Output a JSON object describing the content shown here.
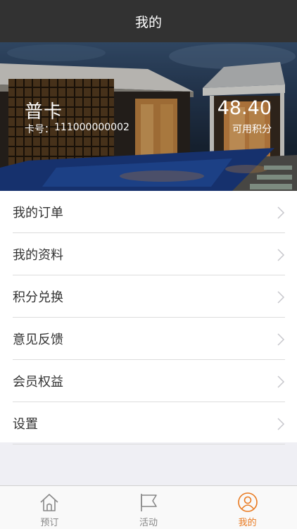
{
  "navbar": {
    "title": "我的"
  },
  "member_card": {
    "card_name": "普卡",
    "card_number_label": "卡号：",
    "card_number": "111000000002",
    "points": "48.40",
    "points_label": "可用积分"
  },
  "menu": {
    "items": [
      {
        "label": "我的订单"
      },
      {
        "label": "我的资料"
      },
      {
        "label": "积分兑换"
      },
      {
        "label": "意见反馈"
      },
      {
        "label": "会员权益"
      },
      {
        "label": "设置"
      }
    ]
  },
  "tabbar": {
    "tabs": [
      {
        "label": "预订",
        "icon": "home-icon",
        "active": false
      },
      {
        "label": "活动",
        "icon": "flag-icon",
        "active": false
      },
      {
        "label": "我的",
        "icon": "user-icon",
        "active": true
      }
    ]
  },
  "colors": {
    "navbar": "#323232",
    "accent": "#e9791f",
    "inactive": "#888888",
    "background": "#efeff4"
  }
}
